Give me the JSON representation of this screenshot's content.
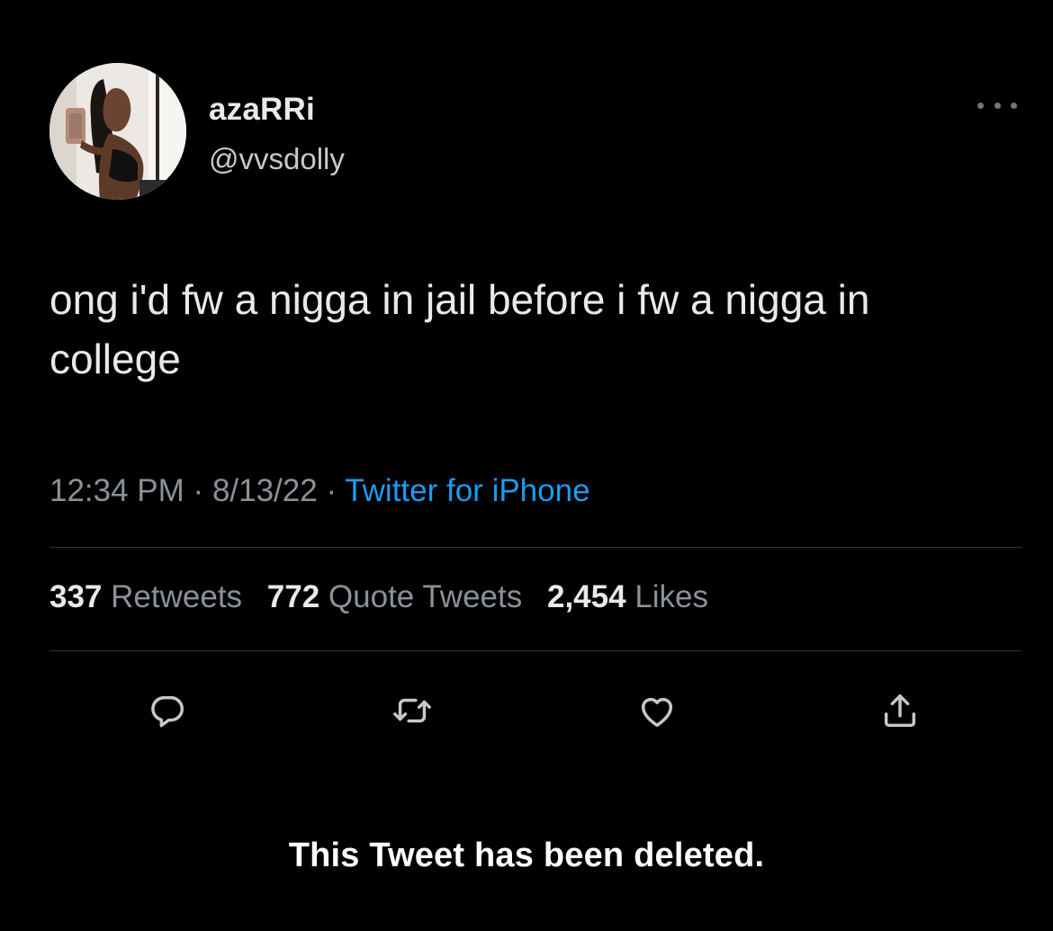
{
  "user": {
    "display_name": "azaRRi",
    "handle": "@vvsdolly",
    "avatar_icon": "profile-photo"
  },
  "tweet": {
    "text": "ong i'd fw a nigga in jail before i fw a nigga in college",
    "time": "12:34 PM",
    "date": "8/13/22",
    "source": "Twitter for iPhone",
    "separator": "·"
  },
  "stats": {
    "retweets_count": "337",
    "retweets_label": "Retweets",
    "quotes_count": "772",
    "quotes_label": "Quote Tweets",
    "likes_count": "2,454",
    "likes_label": "Likes"
  },
  "actions": [
    {
      "icon": "reply-icon"
    },
    {
      "icon": "retweet-icon"
    },
    {
      "icon": "like-icon"
    },
    {
      "icon": "share-icon"
    }
  ],
  "notice": "This Tweet has been deleted.",
  "colors": {
    "background": "#000000",
    "text": "#e7e9ea",
    "secondary": "#8b9198",
    "link": "#1d9bf0",
    "divider": "#2f3336"
  }
}
